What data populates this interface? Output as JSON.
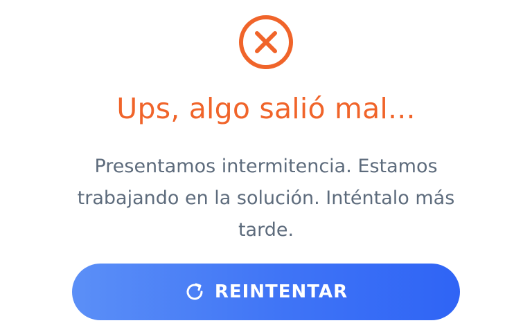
{
  "error": {
    "icon": "close-circle-icon",
    "title": "Ups, algo salió mal...",
    "message": "Presentamos intermitencia. Estamos trabajando en la solución. Inténtalo más tarde."
  },
  "retry_button": {
    "icon": "refresh-icon",
    "label": "REINTENTAR"
  },
  "colors": {
    "accent_orange": "#f0642a",
    "text_muted": "#5d6b7c",
    "button_blue": "#3f74f6",
    "background": "#ffffff"
  }
}
